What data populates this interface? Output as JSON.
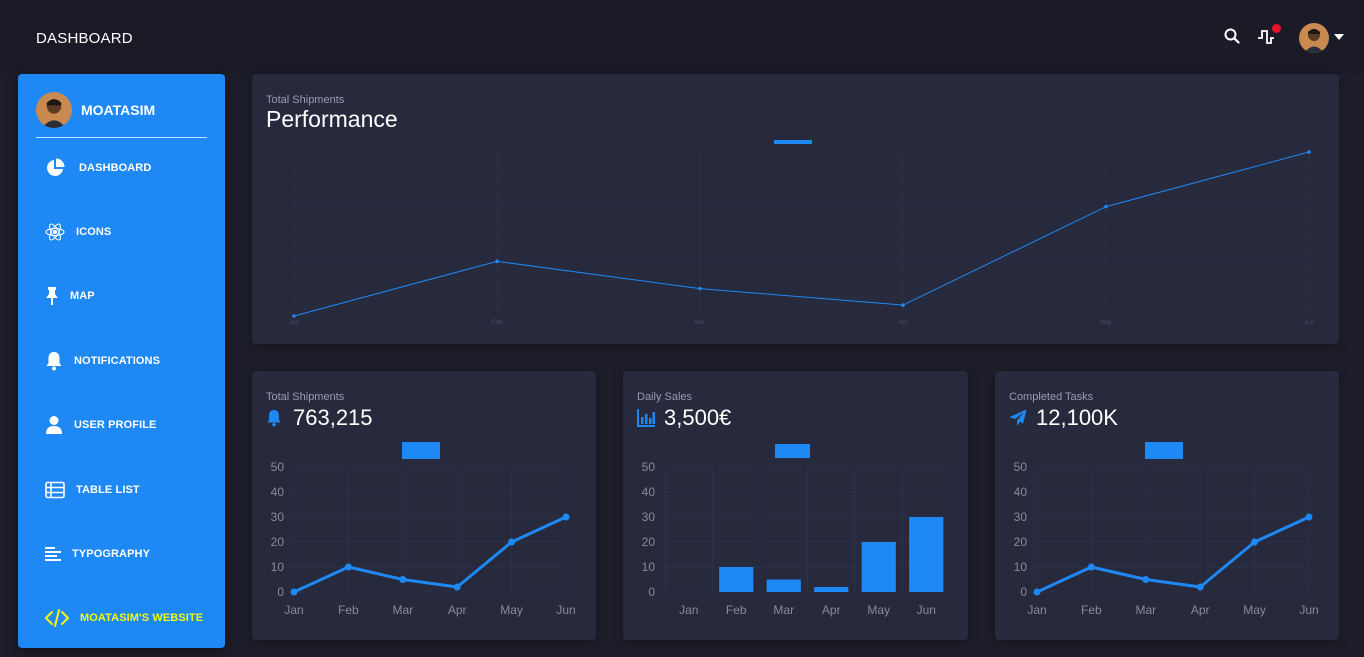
{
  "header": {
    "title": "DASHBOARD"
  },
  "user": {
    "name": "MOATASIM"
  },
  "sidebar": {
    "items": [
      {
        "label": "DASHBOARD",
        "icon": "pie-chart-icon"
      },
      {
        "label": "ICONS",
        "icon": "atom-icon"
      },
      {
        "label": "MAP",
        "icon": "pin-icon"
      },
      {
        "label": "NOTIFICATIONS",
        "icon": "bell-icon"
      },
      {
        "label": "USER PROFILE",
        "icon": "user-icon"
      },
      {
        "label": "TABLE LIST",
        "icon": "table-icon"
      },
      {
        "label": "TYPOGRAPHY",
        "icon": "typography-icon"
      },
      {
        "label": "MOATASIM'S WEBSITE",
        "icon": "code-icon"
      }
    ]
  },
  "colors": {
    "accent": "#1e88f5",
    "card": "#27293d",
    "bg": "#1e1e2b",
    "highlight": "#f6f80d",
    "notification": "#e8132b"
  },
  "performance": {
    "subtitle": "Total Shipments",
    "title": "Performance"
  },
  "cards": [
    {
      "subtitle": "Total Shipments",
      "value": "763,215",
      "icon": "bell-icon"
    },
    {
      "subtitle": "Daily Sales",
      "value": "3,500€",
      "icon": "bar-chart-icon"
    },
    {
      "subtitle": "Completed Tasks",
      "value": "12,100K",
      "icon": "paper-plane-icon"
    }
  ],
  "chart_data": [
    {
      "type": "line",
      "categories": [
        "Jan",
        "Feb",
        "Mar",
        "Apr",
        "May",
        "Jun"
      ],
      "values": [
        0,
        20,
        10,
        4,
        40,
        60
      ],
      "ylim": [
        0,
        60
      ]
    },
    {
      "type": "line",
      "categories": [
        "Jan",
        "Feb",
        "Mar",
        "Apr",
        "May",
        "Jun"
      ],
      "values": [
        0,
        10,
        5,
        2,
        20,
        30
      ],
      "yticks": [
        0,
        10,
        20,
        30,
        40,
        50
      ],
      "ylim": [
        0,
        50
      ]
    },
    {
      "type": "bar",
      "categories": [
        "Jan",
        "Feb",
        "Mar",
        "Apr",
        "May",
        "Jun"
      ],
      "values": [
        0,
        10,
        5,
        2,
        20,
        30
      ],
      "yticks": [
        0,
        10,
        20,
        30,
        40,
        50
      ],
      "ylim": [
        0,
        50
      ]
    },
    {
      "type": "line",
      "categories": [
        "Jan",
        "Feb",
        "Mar",
        "Apr",
        "May",
        "Jun"
      ],
      "values": [
        0,
        10,
        5,
        2,
        20,
        30
      ],
      "yticks": [
        0,
        10,
        20,
        30,
        40,
        50
      ],
      "ylim": [
        0,
        50
      ]
    }
  ]
}
